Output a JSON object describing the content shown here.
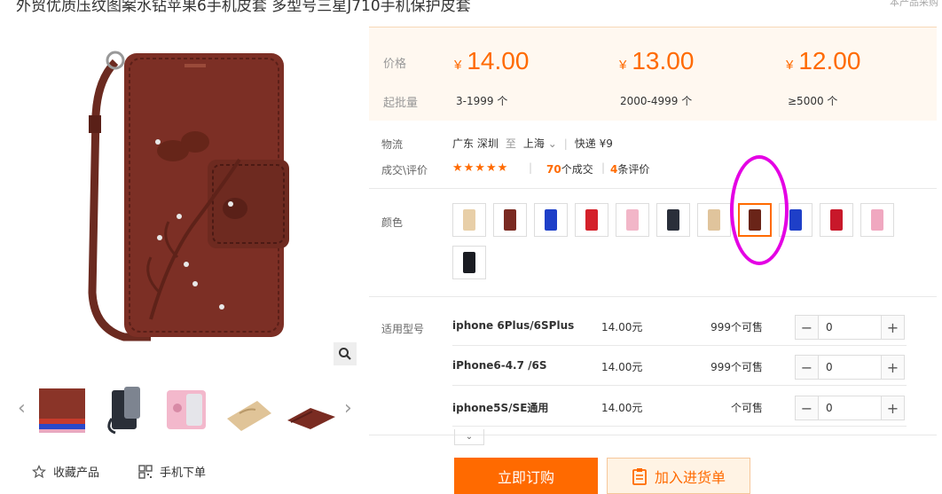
{
  "product": {
    "title": "外贸优质压纹图案水钻苹果6手机皮套 多型号三星J710手机保护皮套",
    "title_right": "本产品采购"
  },
  "pricing": {
    "price_label": "价格",
    "qty_label": "起批量",
    "currency": "¥",
    "tiers": [
      {
        "price": "14.00",
        "range": "3-1999 个"
      },
      {
        "price": "13.00",
        "range": "2000-4999 个"
      },
      {
        "price": "12.00",
        "range": "≥5000 个"
      }
    ]
  },
  "logistics": {
    "label": "物流",
    "from": "广东 深圳",
    "to_word": "至",
    "to": "上海",
    "shipping": "快递 ¥9"
  },
  "reviews": {
    "label": "成交\\评价",
    "stars": "★★★★★",
    "deals_count": "70",
    "deals_suffix": "个成交",
    "review_count": "4",
    "review_suffix": "条评价"
  },
  "color": {
    "label": "颜色",
    "swatches": [
      {
        "color": "#e8cfa8"
      },
      {
        "color": "#7a2a22"
      },
      {
        "color": "#1e3fc8"
      },
      {
        "color": "#d4202a"
      },
      {
        "color": "#f2b6c8"
      },
      {
        "color": "#2a2f3a"
      },
      {
        "color": "#e0c49c"
      },
      {
        "color": "#6a2418"
      },
      {
        "color": "#1e3fc8"
      },
      {
        "color": "#c8182a"
      },
      {
        "color": "#f0a8c0"
      },
      {
        "color": "#1a1c22"
      }
    ],
    "selected_index": 7
  },
  "models": {
    "label": "适用型号",
    "rows": [
      {
        "name": "iphone 6Plus/6SPlus",
        "price": "14.00元",
        "stock": "999个可售",
        "qty": "0"
      },
      {
        "name": "iPhone6-4.7 /6S",
        "price": "14.00元",
        "stock": "999个可售",
        "qty": "0"
      },
      {
        "name": "iphone5S/SE通用",
        "price": "14.00元",
        "stock": "个可售",
        "qty": "0"
      }
    ]
  },
  "actions": {
    "buy_label": "立即订购",
    "cart_label": "加入进货单",
    "favorite_label": "收藏产品",
    "mobile_order_label": "手机下单"
  },
  "icons": {
    "zoom": "magnifier-icon",
    "favorite": "star-outline-icon",
    "qr": "qr-code-icon",
    "cart": "clipboard-icon"
  },
  "accent_color": "#ff6a00"
}
